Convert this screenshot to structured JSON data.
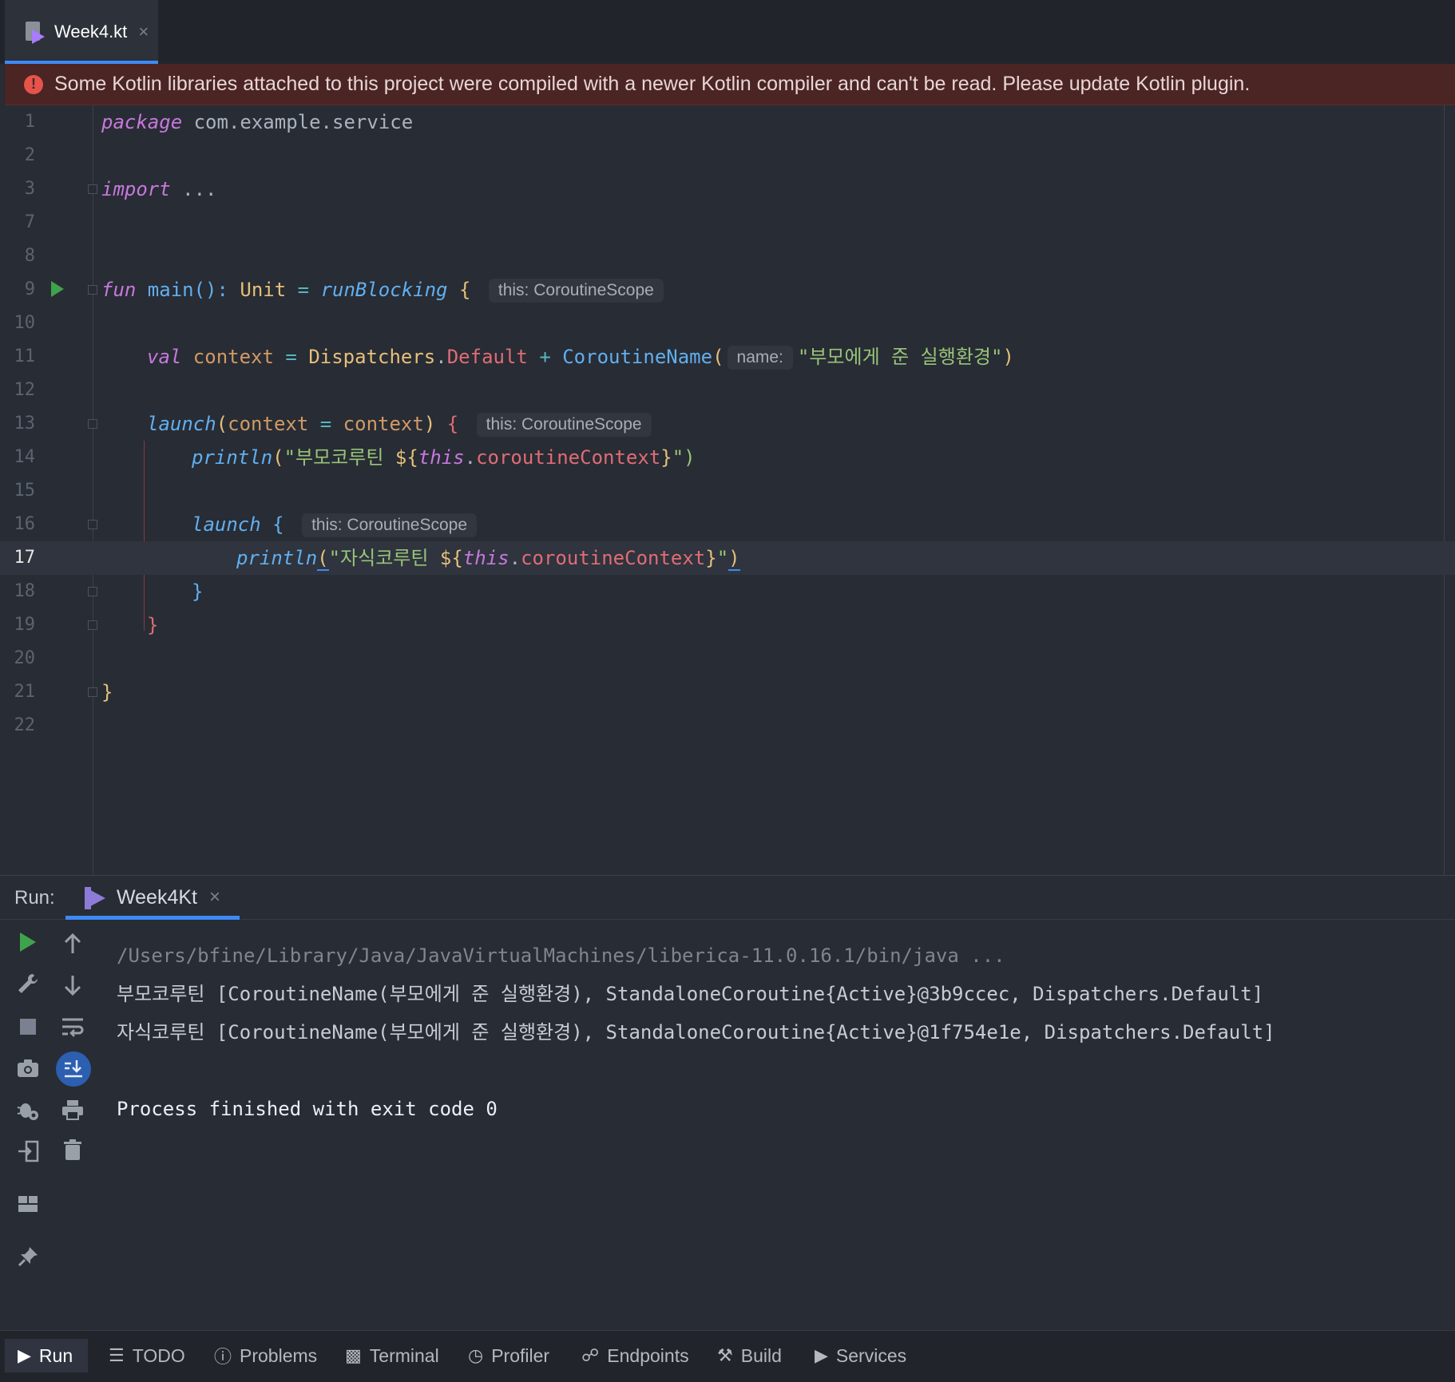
{
  "tab": {
    "file_name": "Week4.kt",
    "close": "×"
  },
  "banner": {
    "message": "Some Kotlin libraries attached to this project were compiled with a newer Kotlin compiler and can't be read. Please update Kotlin plugin."
  },
  "editor": {
    "line_numbers": [
      "1",
      "2",
      "3",
      "7",
      "8",
      "9",
      "10",
      "11",
      "12",
      "13",
      "14",
      "15",
      "16",
      "17",
      "18",
      "19",
      "20",
      "21",
      "22"
    ],
    "current_line": "17",
    "code": {
      "l1_kw": "package",
      "l1_pkg": " com.example.service",
      "l3_kw": "import",
      "l3_rest": " ...",
      "l9_kw": "fun",
      "l9_main": " main",
      "l9_paren": "(): ",
      "l9_unit": "Unit",
      "l9_eq": " = ",
      "l9_run": "runBlocking",
      "l9_brace": " {",
      "hint_scope": "this: CoroutineScope",
      "l11_val": "val",
      "l11_ctx": " context",
      "l11_eq": " = ",
      "l11_disp": "Dispatchers",
      "l11_dot": ".",
      "l11_def": "Default",
      "l11_plus": " + ",
      "l11_cn": "CoroutineName",
      "l11_open": "(",
      "hint_name": "name:",
      "l11_str": "\"부모에게 준 실행환경\"",
      "l11_close": ")",
      "l13_launch": "launch",
      "l13_open": "(",
      "l13_param": "context",
      "l13_eq": " = ",
      "l13_arg": "context",
      "l13_close": ")",
      "l13_brace": " {",
      "l14_println": "println",
      "l14_open": "(",
      "l14_str": "\"부모코루틴 ",
      "l14_tpl": "${",
      "l14_this": "this",
      "l14_dot": ".",
      "l14_prop": "coroutineContext",
      "l14_tpl_end": "}",
      "l14_end": "\")",
      "l16_launch": "launch",
      "l16_brace": " {",
      "l17_println": "println",
      "l17_open": "(",
      "l17_str": "\"자식코루틴 ",
      "l17_tpl": "${",
      "l17_this": "this",
      "l17_dot": ".",
      "l17_prop": "coroutineContext",
      "l17_tpl_end": "}",
      "l17_strend": "\"",
      "l17_close": ")",
      "l18_brace": "}",
      "l19_brace": "}",
      "l21_brace": "}"
    }
  },
  "run_panel": {
    "title": "Run:",
    "tab_label": "Week4Kt",
    "tab_close": "×",
    "console": [
      "/Users/bfine/Library/Java/JavaVirtualMachines/liberica-11.0.16.1/bin/java ...",
      "부모코루틴 [CoroutineName(부모에게 준 실행환경), StandaloneCoroutine{Active}@3b9ccec, Dispatchers.Default]",
      "자식코루틴 [CoroutineName(부모에게 준 실행환경), StandaloneCoroutine{Active}@1f754e1e, Dispatchers.Default]",
      "Process finished with exit code 0"
    ],
    "left_tools": [
      "run-icon",
      "wrench-icon",
      "stop-icon",
      "camera-icon",
      "debug-settings-icon",
      "exit-icon",
      "layout-icon",
      "pin-icon"
    ],
    "right_tools": [
      "up-arrow-icon",
      "down-arrow-icon",
      "soft-wrap-icon",
      "scroll-to-end-icon",
      "print-icon",
      "trash-icon"
    ]
  },
  "bottom_bar": {
    "items": [
      "Run",
      "TODO",
      "Problems",
      "Terminal",
      "Profiler",
      "Endpoints",
      "Build",
      "Services"
    ],
    "active": "Run"
  },
  "colors": {
    "background": "#282c34",
    "accent": "#3d8af7",
    "banner_bg": "#4b2424",
    "keyword": "#c678dd",
    "string": "#98c379",
    "run_green": "#3fa34d"
  }
}
